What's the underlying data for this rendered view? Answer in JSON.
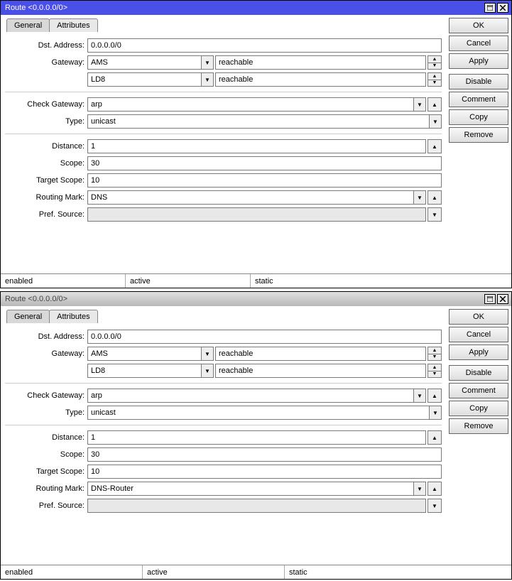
{
  "windows": [
    {
      "title": "Route <0.0.0.0/0>",
      "active": true,
      "tabs": {
        "general": "General",
        "attributes": "Attributes",
        "activeTab": "general"
      },
      "labels": {
        "dst": "Dst. Address:",
        "gateway": "Gateway:",
        "checkgw": "Check Gateway:",
        "type": "Type:",
        "distance": "Distance:",
        "scope": "Scope:",
        "targetscope": "Target Scope:",
        "routingmark": "Routing Mark:",
        "prefsource": "Pref. Source:"
      },
      "values": {
        "dst": "0.0.0.0/0",
        "gw1_name": "AMS",
        "gw1_status": "reachable",
        "gw2_name": "LD8",
        "gw2_status": "reachable",
        "checkgw": "arp",
        "type": "unicast",
        "distance": "1",
        "scope": "30",
        "targetscope": "10",
        "routingmark": "DNS",
        "prefsource": ""
      },
      "buttons": {
        "ok": "OK",
        "cancel": "Cancel",
        "apply": "Apply",
        "disable": "Disable",
        "comment": "Comment",
        "copy": "Copy",
        "remove": "Remove"
      },
      "status": {
        "s1": "enabled",
        "s2": "active",
        "s3": "static"
      },
      "statusWidths": {
        "w1": "176px",
        "w2": "176px",
        "w3": "auto"
      }
    },
    {
      "title": "Route <0.0.0.0/0>",
      "active": false,
      "tabs": {
        "general": "General",
        "attributes": "Attributes",
        "activeTab": "general"
      },
      "labels": {
        "dst": "Dst. Address:",
        "gateway": "Gateway:",
        "checkgw": "Check Gateway:",
        "type": "Type:",
        "distance": "Distance:",
        "scope": "Scope:",
        "targetscope": "Target Scope:",
        "routingmark": "Routing Mark:",
        "prefsource": "Pref. Source:"
      },
      "values": {
        "dst": "0.0.0.0/0",
        "gw1_name": "AMS",
        "gw1_status": "reachable",
        "gw2_name": "LD8",
        "gw2_status": "reachable",
        "checkgw": "arp",
        "type": "unicast",
        "distance": "1",
        "scope": "30",
        "targetscope": "10",
        "routingmark": "DNS-Router",
        "prefsource": ""
      },
      "buttons": {
        "ok": "OK",
        "cancel": "Cancel",
        "apply": "Apply",
        "disable": "Disable",
        "comment": "Comment",
        "copy": "Copy",
        "remove": "Remove"
      },
      "status": {
        "s1": "enabled",
        "s2": "active",
        "s3": "static"
      },
      "statusWidths": {
        "w1": "200px",
        "w2": "200px",
        "w3": "auto"
      }
    }
  ]
}
